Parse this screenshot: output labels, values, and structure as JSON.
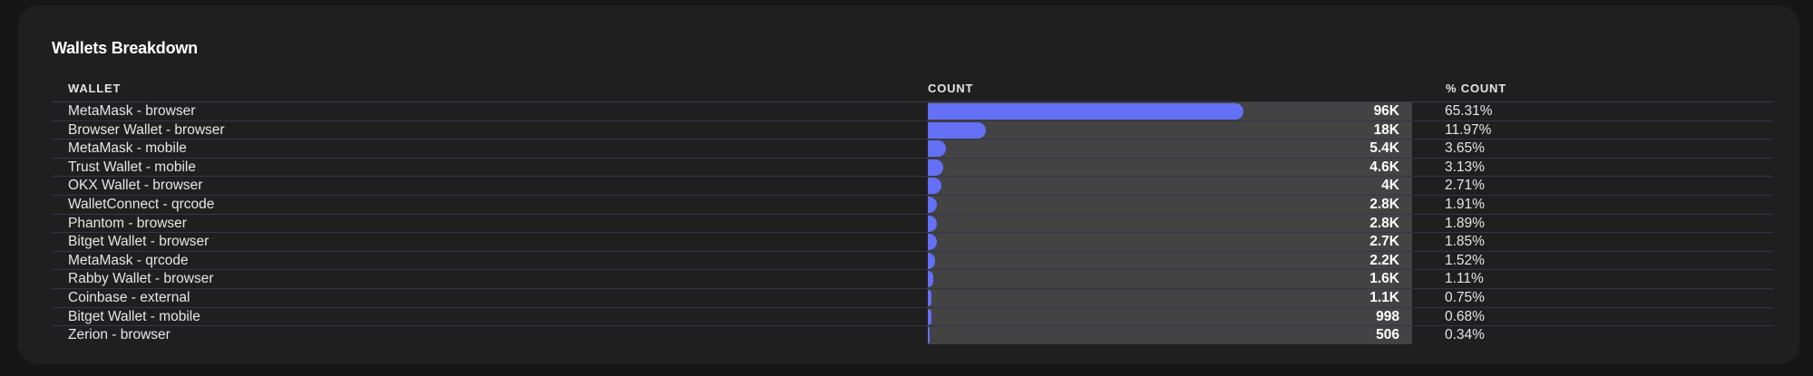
{
  "card": {
    "title": "Wallets Breakdown"
  },
  "table": {
    "headers": {
      "wallet": "WALLET",
      "count": "COUNT",
      "pct": "% COUNT"
    },
    "max_count": 96000,
    "rows": [
      {
        "wallet": "MetaMask - browser",
        "count_label": "96K",
        "count": 96000,
        "pct": "65.31%"
      },
      {
        "wallet": "Browser Wallet - browser",
        "count_label": "18K",
        "count": 17600,
        "pct": "11.97%"
      },
      {
        "wallet": "MetaMask - mobile",
        "count_label": "5.4K",
        "count": 5400,
        "pct": "3.65%"
      },
      {
        "wallet": "Trust Wallet - mobile",
        "count_label": "4.6K",
        "count": 4600,
        "pct": "3.13%"
      },
      {
        "wallet": "OKX Wallet - browser",
        "count_label": "4K",
        "count": 4000,
        "pct": "2.71%"
      },
      {
        "wallet": "WalletConnect - qrcode",
        "count_label": "2.8K",
        "count": 2810,
        "pct": "1.91%"
      },
      {
        "wallet": "Phantom - browser",
        "count_label": "2.8K",
        "count": 2780,
        "pct": "1.89%"
      },
      {
        "wallet": "Bitget Wallet - browser",
        "count_label": "2.7K",
        "count": 2720,
        "pct": "1.85%"
      },
      {
        "wallet": "MetaMask - qrcode",
        "count_label": "2.2K",
        "count": 2240,
        "pct": "1.52%"
      },
      {
        "wallet": "Rabby Wallet - browser",
        "count_label": "1.6K",
        "count": 1630,
        "pct": "1.11%"
      },
      {
        "wallet": "Coinbase - external",
        "count_label": "1.1K",
        "count": 1100,
        "pct": "0.75%"
      },
      {
        "wallet": "Bitget Wallet - mobile",
        "count_label": "998",
        "count": 998,
        "pct": "0.68%"
      },
      {
        "wallet": "Zerion - browser",
        "count_label": "506",
        "count": 506,
        "pct": "0.34%"
      }
    ]
  },
  "colors": {
    "bar": "#6470f6",
    "track": "#434343",
    "card": "#1f1f1f",
    "background": "#161616"
  }
}
